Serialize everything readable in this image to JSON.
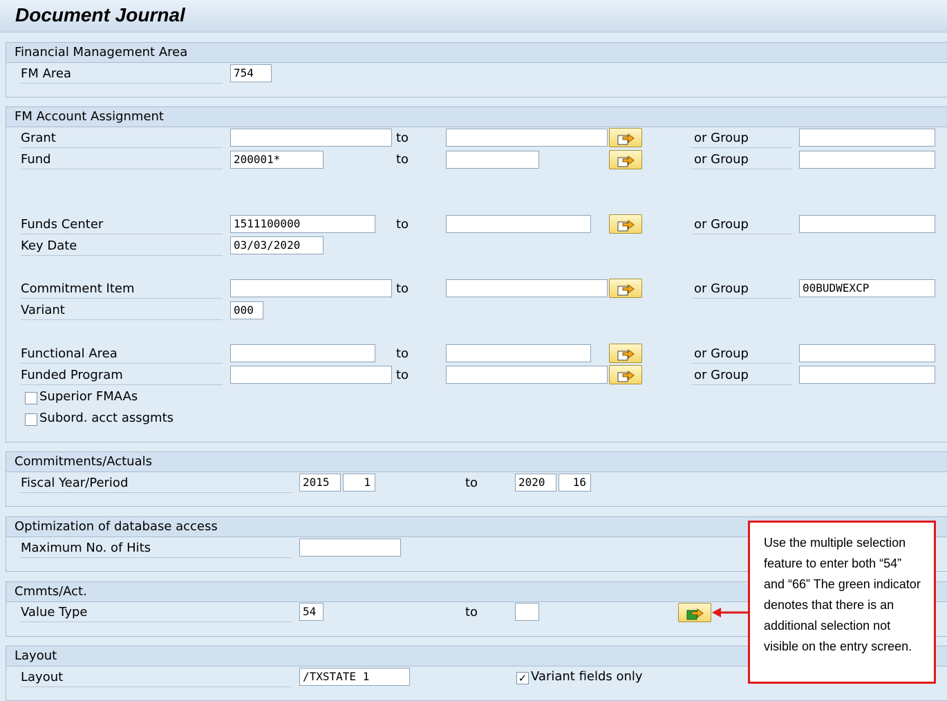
{
  "page_title": "Document Journal",
  "sections": {
    "fm_area": {
      "header": "Financial Management Area",
      "label": "FM Area",
      "value": "754"
    },
    "account_assignment": {
      "header": "FM Account Assignment",
      "to_label": "to",
      "or_group_label": "or Group",
      "grant": {
        "label": "Grant",
        "from": "",
        "to": "",
        "group": ""
      },
      "fund": {
        "label": "Fund",
        "from": "200001*",
        "to": "",
        "group": ""
      },
      "funds_center": {
        "label": "Funds Center",
        "from": "1511100000",
        "to": "",
        "group": ""
      },
      "key_date": {
        "label": "Key Date",
        "value": "03/03/2020"
      },
      "commitment_item": {
        "label": "Commitment Item",
        "from": "",
        "to": "",
        "group": "00BUDWEXCP"
      },
      "variant": {
        "label": "Variant",
        "value": "000"
      },
      "functional_area": {
        "label": "Functional Area",
        "from": "",
        "to": "",
        "group": ""
      },
      "funded_program": {
        "label": "Funded Program",
        "from": "",
        "to": "",
        "group": ""
      },
      "superior_fmaas": {
        "label": "Superior FMAAs",
        "checked": false
      },
      "subord_acct": {
        "label": "Subord. acct assgmts",
        "checked": false
      }
    },
    "commitments_actuals": {
      "header": "Commitments/Actuals",
      "label": "Fiscal Year/Period",
      "from_year": "2015",
      "from_period": "1",
      "to_label": "to",
      "to_year": "2020",
      "to_period": "16"
    },
    "optimization": {
      "header": "Optimization of database access",
      "label": "Maximum No. of Hits",
      "value": ""
    },
    "cmmts_act": {
      "header": "Cmmts/Act.",
      "label": "Value Type",
      "from": "54",
      "to_label": "to",
      "to": ""
    },
    "layout": {
      "header": "Layout",
      "label": "Layout",
      "value": "/TXSTATE 1",
      "variant_fields_only": {
        "label": "Variant fields only",
        "checked": true
      }
    }
  },
  "callout": {
    "text": "Use the multiple selection feature to enter both “54” and “66” The green indicator denotes that there is an additional selection not visible on the entry screen.",
    "border_color": "#e31818"
  },
  "colors": {
    "background": "#dfebf5",
    "header": "#d2e1ef",
    "multi_select_yellow": "#f5d86a",
    "multi_select_green": "#2e9e2e"
  }
}
